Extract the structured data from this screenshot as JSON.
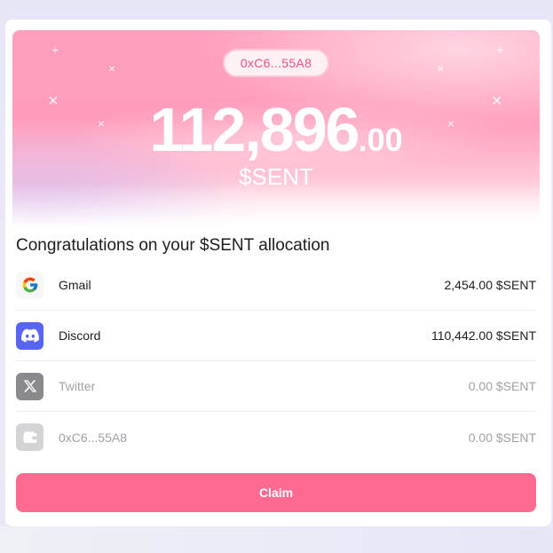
{
  "hero": {
    "address": "0xC6...55A8",
    "amount_int": "112,896",
    "amount_dec": ".00",
    "currency": "$SENT"
  },
  "heading": "Congratulations on your $SENT allocation",
  "sources": [
    {
      "label": "Gmail",
      "value": "2,454.00 $SENT",
      "icon": "google-icon"
    },
    {
      "label": "Discord",
      "value": "110,442.00 $SENT",
      "icon": "discord-icon"
    },
    {
      "label": "Twitter",
      "value": "0.00 $SENT",
      "icon": "x-icon"
    },
    {
      "label": "0xC6...55A8",
      "value": "0.00 $SENT",
      "icon": "wallet-icon"
    }
  ],
  "claim_label": "Claim",
  "colors": {
    "accent": "#ff6a91",
    "pill_text": "#f2507c",
    "discord": "#5865f2",
    "muted_icon": "#8a8a8e"
  }
}
